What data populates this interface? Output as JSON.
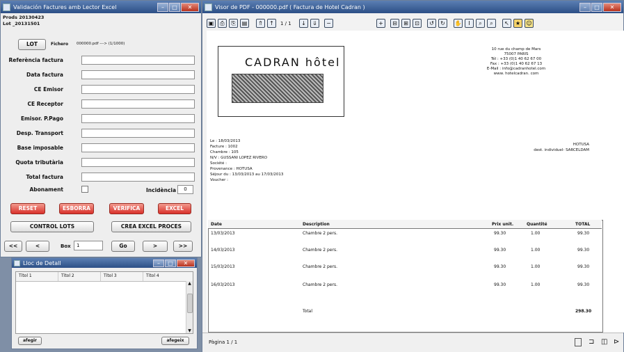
{
  "left_window": {
    "title": "Validación Factures amb Lector Excel",
    "header_line1": "Prods 20130423",
    "header_line2": "Lot _20131501",
    "lot_button": "LOT",
    "fitxer_label": "Fichero",
    "fitxer_value": "000000.pdf ---> (1/1000)",
    "fields": [
      "Referència factura",
      "Data factura",
      "CE Emisor",
      "CE Receptor",
      "Emisor. P.Pago",
      "Desp. Transport",
      "Base imposable",
      "Quota tributària",
      "Total factura"
    ],
    "abonament_label": "Abonament",
    "incidencia_label": "Incidència",
    "incidencia_value": "0",
    "buttons": {
      "reset": "RESET",
      "esborra": "ESBORRA",
      "verifica": "VERIFICA",
      "excel": "EXCEL"
    },
    "control_lots": "CONTROL LOTS",
    "crea_excel": "CREA EXCEL PROCES",
    "nav": {
      "first": "<<",
      "prev": "<",
      "box_label": "Box",
      "box_value": "1",
      "go": "Go",
      "next": ">",
      "last": ">>"
    }
  },
  "small_window": {
    "title": "Lloc de Detall",
    "columns": [
      "Títol 1",
      "Títol 2",
      "Títol 3",
      "Títol 4"
    ],
    "left_button": "afegir",
    "right_button": "afegeix"
  },
  "pdf_window": {
    "title": "Visor de PDF - 000000.pdf ( Factura de Hotel Cadran )",
    "status": "Pàgina 1 / 1",
    "page_number": "1 / 1",
    "document": {
      "brand": "CADRAN hôtel",
      "address": [
        "10 rue du champ de Mars",
        "75007 PARIS",
        "Tél : +33 (0)1 40 62 67 00",
        "Fax : +33 (0)1 40 62 67 13",
        "E-Mail : info@cadranhotel.com",
        "www. hotelcadran. com"
      ],
      "meta": [
        "Le : 18/03/2013",
        "Facture : 1002",
        "Chambre : 105",
        "N/V : GUSSANI LOPEZ RIVERO",
        "Société :",
        "Provenance : HOTUSA",
        "Séjour du : 13/03/2013 au 17/03/2013",
        "Voucher :"
      ],
      "client_right": [
        "HOTUSA",
        "dest. individuel- SARCELDAM"
      ],
      "table_headers": [
        "Date",
        "Description",
        "Prix unit.",
        "Quantité",
        "TOTAL"
      ],
      "rows": [
        {
          "date": "13/03/2013",
          "desc": "Chambre 2 pers.",
          "price": "99.30",
          "qty": "1.00",
          "total": "99.30"
        },
        {
          "date": "14/03/2013",
          "desc": "Chambre 2 pers.",
          "price": "99.30",
          "qty": "1.00",
          "total": "99.30"
        },
        {
          "date": "15/03/2013",
          "desc": "Chambre 2 pers.",
          "price": "99.30",
          "qty": "1.00",
          "total": "99.30"
        },
        {
          "date": "16/03/2013",
          "desc": "Chambre 2 pers.",
          "price": "99.30",
          "qty": "1.00",
          "total": "99.30"
        }
      ],
      "total_label": "Total",
      "total_value": "298.30"
    }
  }
}
